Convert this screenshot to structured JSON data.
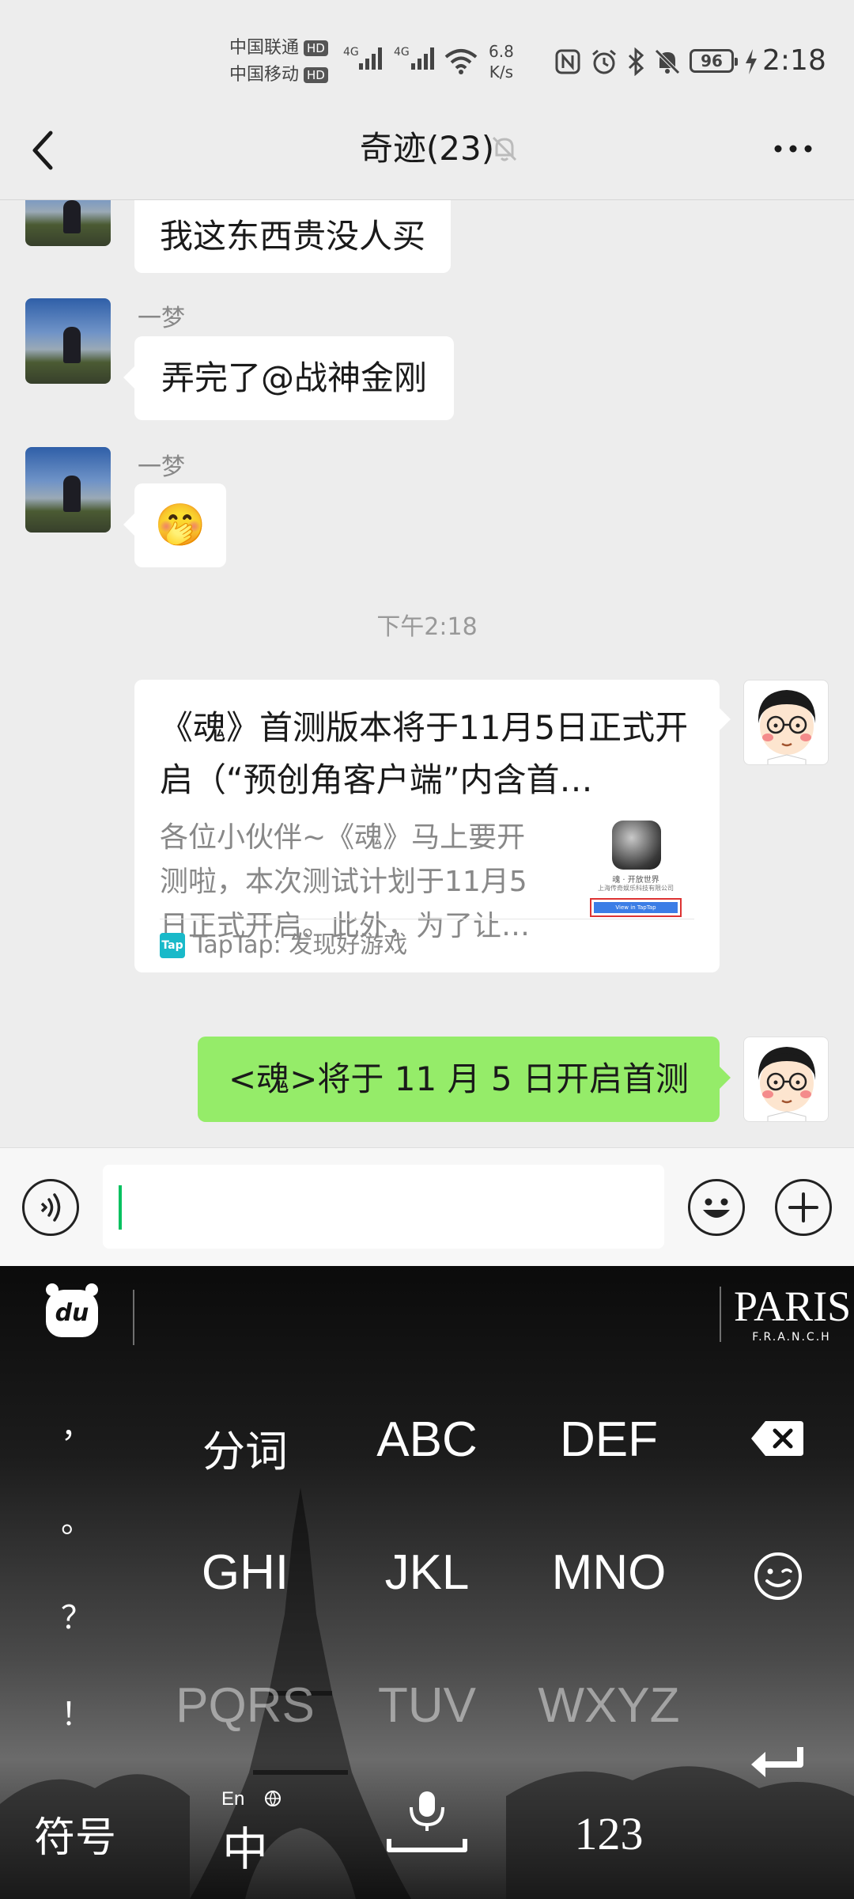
{
  "status_bar": {
    "carrier1": "中国联通",
    "carrier2": "中国移动",
    "hd": "HD",
    "net_type": "4G",
    "net_speed_value": "6.8",
    "net_speed_unit": "K/s",
    "battery": "96",
    "time": "2:18"
  },
  "nav": {
    "back_icon": "chevron-left-icon",
    "title": "奇迹(23)",
    "mute_icon": "bell-off-icon",
    "more_icon": "more-horizontal-icon"
  },
  "messages": [
    {
      "side": "left",
      "sender": "",
      "text": "我这东西贵没人买"
    },
    {
      "side": "left",
      "sender": "一梦",
      "text": "弄完了@战神金刚"
    },
    {
      "side": "left",
      "sender": "一梦",
      "emoji": "🤭"
    }
  ],
  "timestamp": "下午2:18",
  "share_card": {
    "title": "《魂》首测版本将于11月5日正式开启（“预创角客户端”内含首…",
    "description": "各位小伙伴~《魂》马上要开测啦，本次测试计划于11月5日正式开启。此外，为了让…",
    "source_logo": "Tap",
    "source": "TapTap: 发现好游戏",
    "thumb_name": "魂 · 开放世界",
    "thumb_company": "上海传奇娱乐科技有限公司",
    "thumb_button": "View in TapTap"
  },
  "my_message": "<魂>将于 11 月 5 日开启首测",
  "input": {
    "voice_icon": "voice-icon",
    "emoji_icon": "emoji-icon",
    "plus_icon": "plus-icon"
  },
  "keyboard": {
    "logo": "du",
    "theme": "PARIS",
    "theme_sub": "F.R.A.N.C.H",
    "punctuation": [
      "，",
      "。",
      "？",
      "！"
    ],
    "rows": [
      [
        "分词",
        "ABC",
        "DEF"
      ],
      [
        "GHI",
        "JKL",
        "MNO"
      ],
      [
        "PQRS",
        "TUV",
        "WXYZ"
      ]
    ],
    "symbols": "符号",
    "lang_small": "En",
    "lang_big": "中",
    "numbers": "123"
  }
}
